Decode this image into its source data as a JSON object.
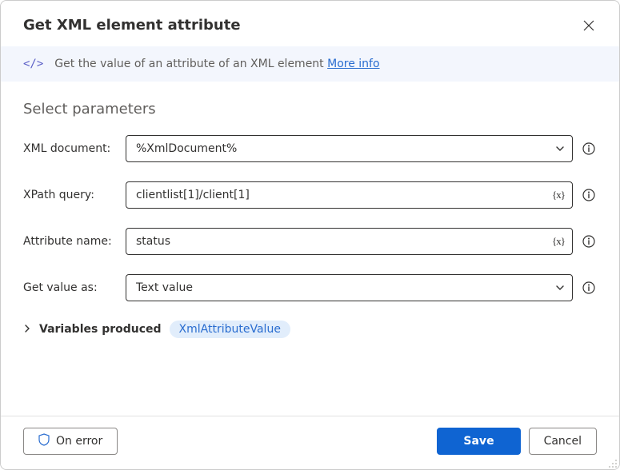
{
  "dialog": {
    "title": "Get XML element attribute"
  },
  "banner": {
    "text": "Get the value of an attribute of an XML element ",
    "link": "More info"
  },
  "section": {
    "title": "Select parameters"
  },
  "fields": {
    "xml_document": {
      "label": "XML document:",
      "value": "%XmlDocument%"
    },
    "xpath_query": {
      "label": "XPath query:",
      "value": "clientlist[1]/client[1]"
    },
    "attribute": {
      "label": "Attribute name:",
      "value": "status"
    },
    "get_value_as": {
      "label": "Get value as:",
      "value": "Text value"
    }
  },
  "variables": {
    "label": "Variables produced",
    "badge": "XmlAttributeValue"
  },
  "buttons": {
    "on_error": "On error",
    "save": "Save",
    "cancel": "Cancel"
  },
  "icons": {
    "var_brace": "{x}"
  }
}
